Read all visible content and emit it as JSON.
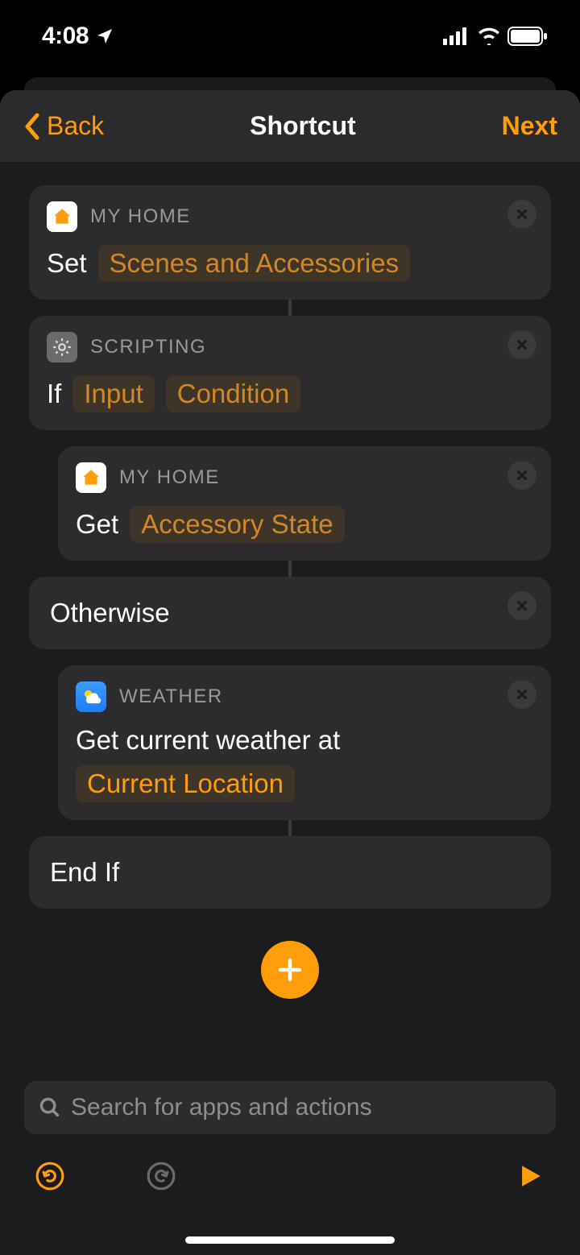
{
  "status": {
    "time": "4:08"
  },
  "nav": {
    "back": "Back",
    "title": "Shortcut",
    "next": "Next"
  },
  "apps": {
    "home": "MY HOME",
    "scripting": "SCRIPTING",
    "weather": "WEATHER"
  },
  "actions": {
    "a1": {
      "verb": "Set",
      "param1": "Scenes and Accessories"
    },
    "a2": {
      "verb": "If",
      "param1": "Input",
      "param2": "Condition"
    },
    "a3": {
      "verb": "Get",
      "param1": "Accessory State"
    },
    "a4": {
      "label": "Otherwise"
    },
    "a5": {
      "verb": "Get current weather at",
      "param1": "Current Location"
    },
    "a6": {
      "label": "End If"
    }
  },
  "search": {
    "placeholder": "Search for apps and actions"
  }
}
